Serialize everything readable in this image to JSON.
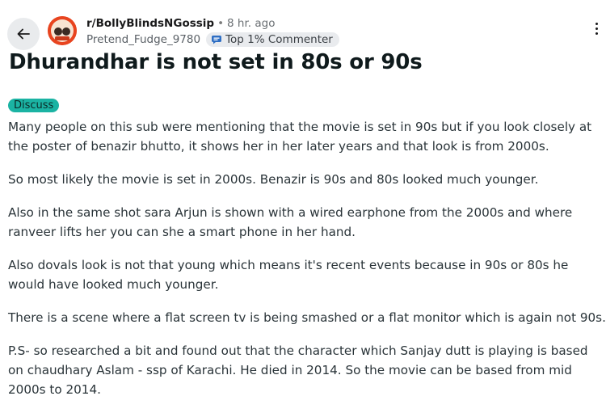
{
  "header": {
    "subreddit": "r/BollyBlindsNGossip",
    "separator": "•",
    "time": "8 hr. ago",
    "username": "Pretend_Fudge_9780",
    "flair": "Top 1% Commenter",
    "icons": {
      "back": "arrow-left-icon",
      "more": "more-options-icon",
      "flair": "commenter-badge-icon",
      "avatar": "subreddit-avatar"
    }
  },
  "post": {
    "title": "Dhurandhar is not set in 80s or 90s",
    "tag": "Discuss",
    "paragraphs": [
      "Many people on this sub were mentioning that the movie is set in 90s but if you look closely at the poster of benazir bhutto, it shows her in her later years and that look is from 2000s.",
      "So most likely the movie is set in 2000s. Benazir is 90s and 80s looked much younger.",
      "Also in the same shot sara Arjun is shown with a wired earphone from the 2000s and where ranveer lifts her you can she a smart phone in her hand.",
      "Also dovals look is not that young which means it's recent events because in 90s or 80s he would have looked much younger.",
      "There is a scene where a flat screen tv is being smashed or a flat monitor which is again not 90s.",
      "P.S- so researched a bit and found out that the character which Sanjay dutt is playing is based on chaudhary Aslam - ssp of Karachi. He died in 2014. So the movie can be based from mid 2000s to 2014."
    ]
  },
  "colors": {
    "tag_bg": "#1bb3a3",
    "avatar_bg": "#e8441f",
    "back_bg": "#e9ebed"
  }
}
